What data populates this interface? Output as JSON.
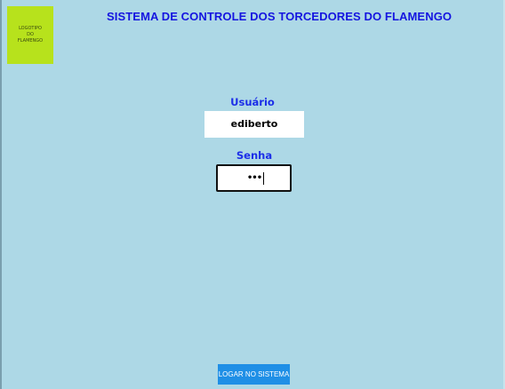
{
  "header": {
    "title": "SISTEMA DE CONTROLE DOS TORCEDORES DO FLAMENGO",
    "logo": {
      "line1": "LOGOTIPO",
      "line2": "DO",
      "line3": "FLAMENGO"
    }
  },
  "form": {
    "user_label": "Usuário",
    "user_value": "ediberto",
    "password_label": "Senha",
    "password_mask": "•••"
  },
  "actions": {
    "login_label": "LOGAR NO SISTEMA"
  },
  "colors": {
    "background": "#add8e6",
    "logo": "#b7e21c",
    "title": "#1515e0",
    "label": "#1c2ee8",
    "button": "#1f8fe6"
  }
}
